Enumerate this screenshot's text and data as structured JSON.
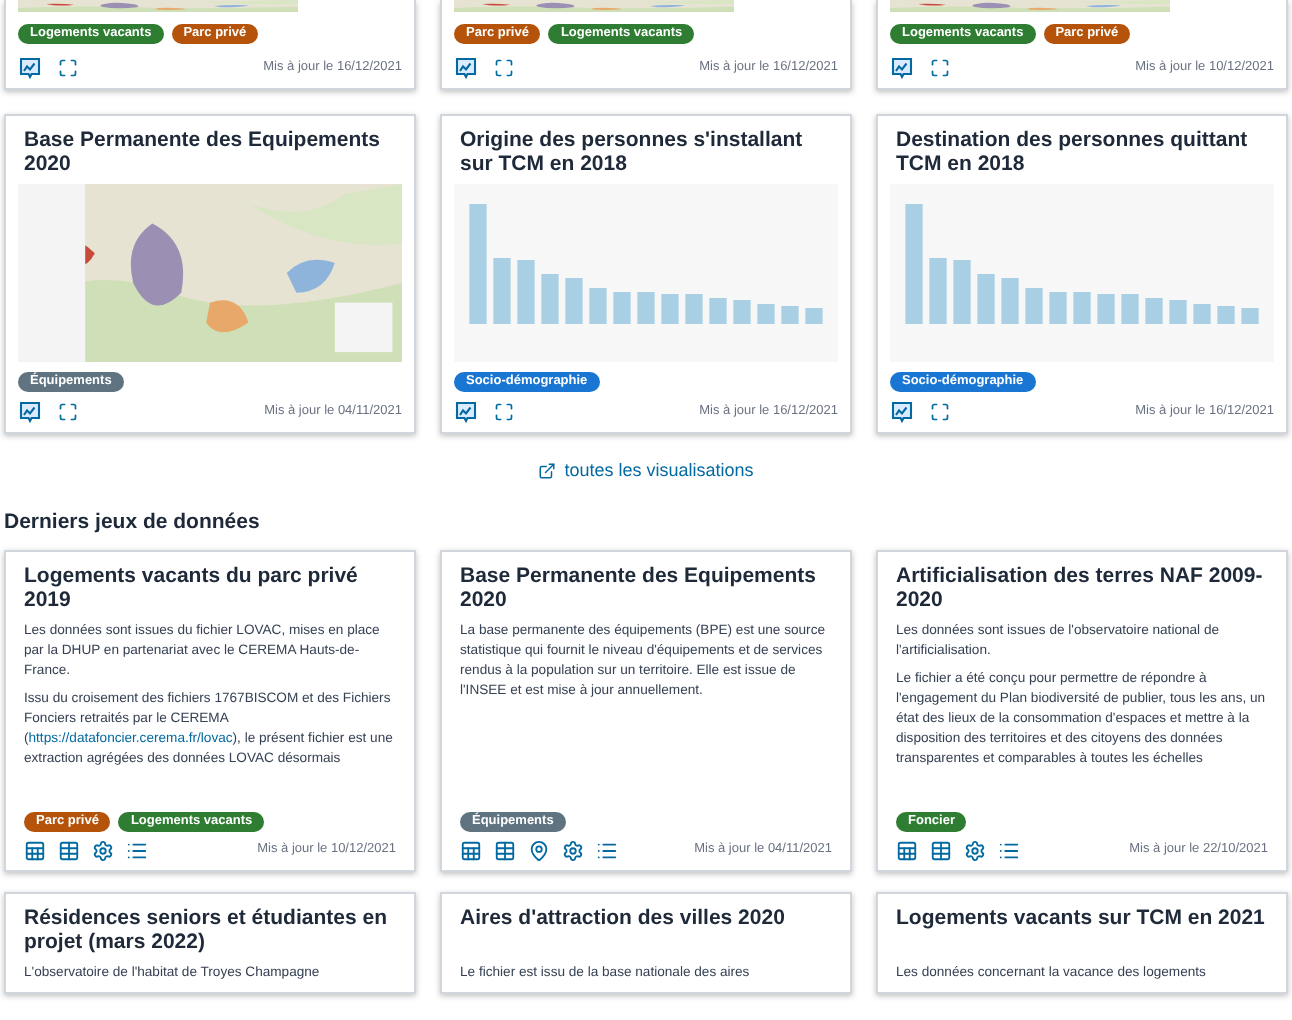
{
  "top_cards": [
    {
      "picture": {
        "kind": "map"
      },
      "tags": [
        {
          "label": "Logements vacants",
          "color": "#2e7d32"
        },
        {
          "label": "Parc privé",
          "color": "#b45309"
        }
      ],
      "actions": [
        {
          "kind": "chart"
        },
        {
          "kind": "expand"
        }
      ],
      "updated": "Mis à jour le 16/12/2021"
    },
    {
      "picture": {
        "kind": "map"
      },
      "tags": [
        {
          "label": "Parc privé",
          "color": "#b45309"
        },
        {
          "label": "Logements vacants",
          "color": "#2e7d32"
        }
      ],
      "actions": [
        {
          "kind": "chart"
        },
        {
          "kind": "expand"
        }
      ],
      "updated": "Mis à jour le 16/12/2021"
    },
    {
      "picture": {
        "kind": "map"
      },
      "tags": [
        {
          "label": "Logements vacants",
          "color": "#2e7d32"
        },
        {
          "label": "Parc privé",
          "color": "#b45309"
        }
      ],
      "actions": [
        {
          "kind": "chart"
        },
        {
          "kind": "expand"
        }
      ],
      "updated": "Mis à jour le 10/12/2021"
    }
  ],
  "visualisations": [
    {
      "title": "Base Permanente des Equipements 2020",
      "picture": {
        "kind": "map"
      },
      "tags": [
        {
          "label": "Équipements",
          "color": "#5f7480"
        }
      ],
      "actions": [
        {
          "kind": "chart"
        },
        {
          "kind": "expand"
        }
      ],
      "updated": "Mis à jour le 04/11/2021"
    },
    {
      "title": "Origine des personnes s'installant sur TCM en 2018",
      "picture": {
        "kind": "bars"
      },
      "tags": [
        {
          "label": "Socio-démographie",
          "color": "#1976d2"
        }
      ],
      "actions": [
        {
          "kind": "chart"
        },
        {
          "kind": "expand"
        }
      ],
      "updated": "Mis à jour le 16/12/2021"
    },
    {
      "title": "Destination des personnes quittant TCM en 2018",
      "picture": {
        "kind": "bars"
      },
      "tags": [
        {
          "label": "Socio-démographie",
          "color": "#1976d2"
        }
      ],
      "actions": [
        {
          "kind": "chart"
        },
        {
          "kind": "expand"
        }
      ],
      "updated": "Mis à jour le 16/12/2021"
    }
  ],
  "all_link": "toutes les visualisations",
  "datasets_heading": "Derniers jeux de données",
  "datasets": [
    {
      "title": "Logements vacants du parc privé 2019",
      "paragraphs": [
        {
          "text": "Les données sont issues du fichier LOVAC, mises en place par la DHUP en partenariat avec le CEREMA Hauts-de-France."
        },
        {
          "text": "Issu du croisement des fichiers 1767BISCOM et des Fichiers Fonciers retraités par le CEREMA (",
          "link": "https://datafoncier.cerema.fr/lovac",
          "text_after": "), le présent fichier est une extraction agrégées des données LOVAC désormais"
        }
      ],
      "tags": [
        {
          "label": "Parc privé",
          "color": "#b45309"
        },
        {
          "label": "Logements vacants",
          "color": "#2e7d32"
        }
      ],
      "actions": [
        {
          "kind": "table-export"
        },
        {
          "kind": "table"
        },
        {
          "kind": "settings"
        },
        {
          "kind": "list"
        }
      ],
      "updated": "Mis à jour le 10/12/2021"
    },
    {
      "title": "Base Permanente des Equipements 2020",
      "paragraphs": [
        {
          "text": "La base permanente des équipements (BPE) est une source statistique qui fournit le niveau d'équipements et de services rendus à la population sur un territoire. Elle est issue de l'INSEE et est mise à jour annuellement."
        }
      ],
      "tags": [
        {
          "label": "Équipements",
          "color": "#5f7480"
        }
      ],
      "actions": [
        {
          "kind": "table-export"
        },
        {
          "kind": "table"
        },
        {
          "kind": "map-pin"
        },
        {
          "kind": "settings"
        },
        {
          "kind": "list"
        }
      ],
      "updated": "Mis à jour le 04/11/2021"
    },
    {
      "title": "Artificialisation des terres NAF 2009-2020",
      "paragraphs": [
        {
          "text": "Les données sont issues de l'observatoire national de l'artificialisation."
        },
        {
          "text": "Le fichier a été conçu pour permettre de répondre à l'engagement du Plan biodiversité de publier, tous les ans, un état des lieux de la consommation d'espaces et mettre à la disposition des territoires et des citoyens des données transparentes et comparables à toutes les échelles"
        }
      ],
      "tags": [
        {
          "label": "Foncier",
          "color": "#2e7d32"
        }
      ],
      "actions": [
        {
          "kind": "table-export"
        },
        {
          "kind": "table"
        },
        {
          "kind": "settings"
        },
        {
          "kind": "list"
        }
      ],
      "updated": "Mis à jour le 22/10/2021"
    },
    {
      "title": "Résidences seniors et étudiantes en projet (mars 2022)",
      "paragraphs": [
        {
          "text": "L'observatoire de l'habitat de Troyes Champagne"
        }
      ]
    },
    {
      "title": "Aires d'attraction des villes 2020",
      "paragraphs": [
        {
          "text": "Le fichier est issu de la base nationale des aires"
        }
      ]
    },
    {
      "title": "Logements vacants sur TCM en 2021",
      "paragraphs": [
        {
          "text": "Les données concernant la vacance des logements"
        }
      ]
    }
  ]
}
